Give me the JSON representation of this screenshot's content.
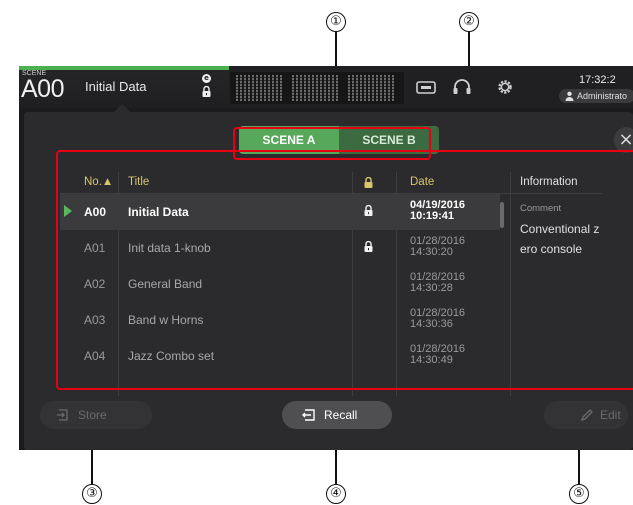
{
  "header": {
    "scene_tag": "SCENE",
    "scene_number": "A00",
    "scene_name": "Initial Data",
    "lock_badge": "e",
    "time": "17:32:2",
    "user": "Administrato"
  },
  "scene_tabs": [
    "SCENE A",
    "SCENE B"
  ],
  "selected_tab": "SCENE A",
  "close_label": "×",
  "table": {
    "columns": {
      "no": "No.▲",
      "title": "Title",
      "date": "Date",
      "info": "Information"
    },
    "rows": [
      {
        "no": "A00",
        "title": "Initial Data",
        "locked": true,
        "date": "04/19/2016",
        "time": "10:19:41",
        "selected": true
      },
      {
        "no": "A01",
        "title": "Init data 1-knob",
        "locked": true,
        "date": "01/28/2016",
        "time": "14:30:20",
        "selected": false
      },
      {
        "no": "A02",
        "title": "General Band",
        "locked": false,
        "date": "01/28/2016",
        "time": "14:30:28",
        "selected": false
      },
      {
        "no": "A03",
        "title": "Band w Horns",
        "locked": false,
        "date": "01/28/2016",
        "time": "14:30:36",
        "selected": false
      },
      {
        "no": "A04",
        "title": "Jazz Combo set",
        "locked": false,
        "date": "01/28/2016",
        "time": "14:30:49",
        "selected": false
      }
    ],
    "info": {
      "comment_label": "Comment",
      "comment_text": "Conventional z ero console"
    }
  },
  "buttons": {
    "store": "Store",
    "recall": "Recall",
    "edit": "Edit"
  },
  "callouts": [
    "①",
    "②",
    "③",
    "④",
    "⑤"
  ],
  "colors": {
    "accent_green": "#58a85c",
    "highlight_red": "#e60012",
    "header_gold": "#d8c46a"
  }
}
